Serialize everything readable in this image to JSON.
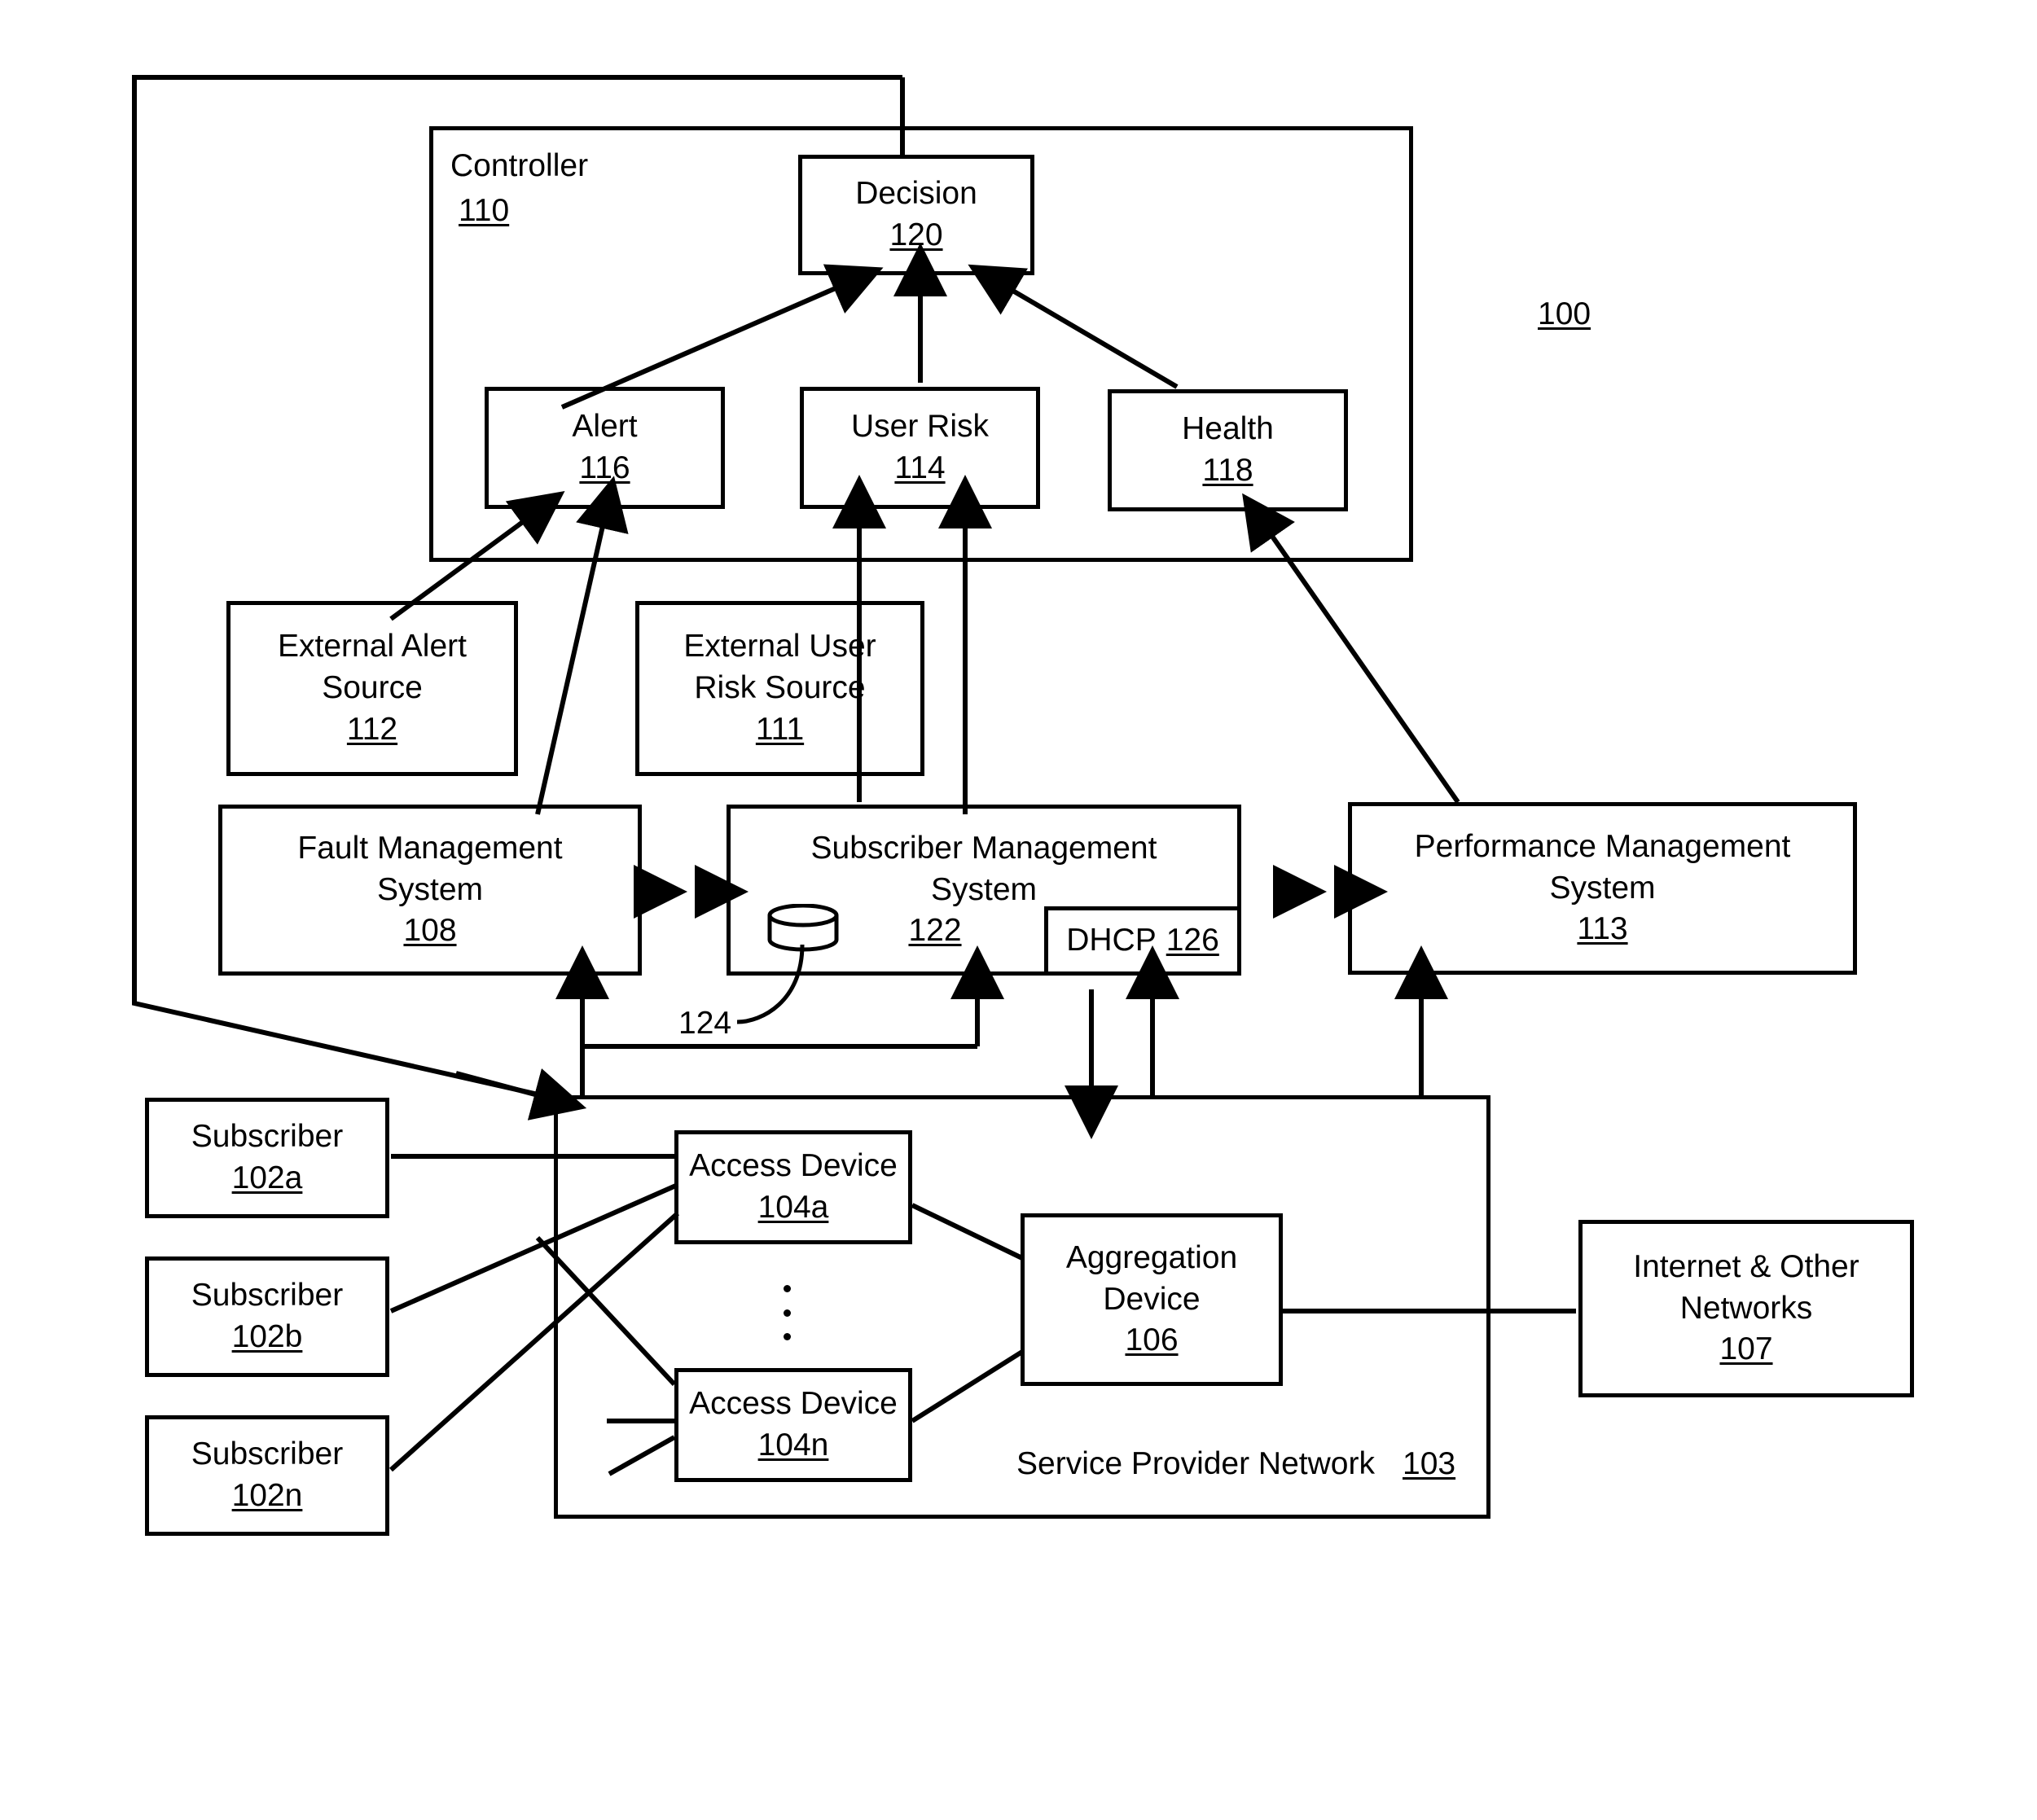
{
  "figure": {
    "ref_label": "100"
  },
  "controller": {
    "title": "Controller",
    "ref": "110"
  },
  "service_provider_network": {
    "title": "Service Provider Network",
    "ref": "103"
  },
  "boxes": {
    "decision": {
      "title": "Decision",
      "ref": "120"
    },
    "alert": {
      "title": "Alert",
      "ref": "116"
    },
    "user_risk": {
      "title": "User Risk",
      "ref": "114"
    },
    "health": {
      "title": "Health",
      "ref": "118"
    },
    "external_alert": {
      "title": "External Alert\nSource",
      "ref": "112"
    },
    "external_user_risk": {
      "title": "External User\nRisk Source",
      "ref": "111"
    },
    "fault_mgmt": {
      "title": "Fault Management\nSystem",
      "ref": "108"
    },
    "subscriber_mgmt": {
      "title": "Subscriber Management\nSystem",
      "ref": "122"
    },
    "dhcp": {
      "title": "DHCP",
      "ref": "126"
    },
    "perf_mgmt": {
      "title": "Performance Management\nSystem",
      "ref": "113"
    },
    "subscriber_a": {
      "title": "Subscriber",
      "ref": "102a"
    },
    "subscriber_b": {
      "title": "Subscriber",
      "ref": "102b"
    },
    "subscriber_n": {
      "title": "Subscriber",
      "ref": "102n"
    },
    "access_device_a": {
      "title": "Access Device",
      "ref": "104a"
    },
    "access_device_n": {
      "title": "Access Device",
      "ref": "104n"
    },
    "aggregation": {
      "title": "Aggregation\nDevice",
      "ref": "106"
    },
    "internet": {
      "title": "Internet & Other\nNetworks",
      "ref": "107"
    }
  },
  "callouts": {
    "database": "124"
  },
  "colors": {
    "stroke": "#000000",
    "background": "#ffffff"
  }
}
